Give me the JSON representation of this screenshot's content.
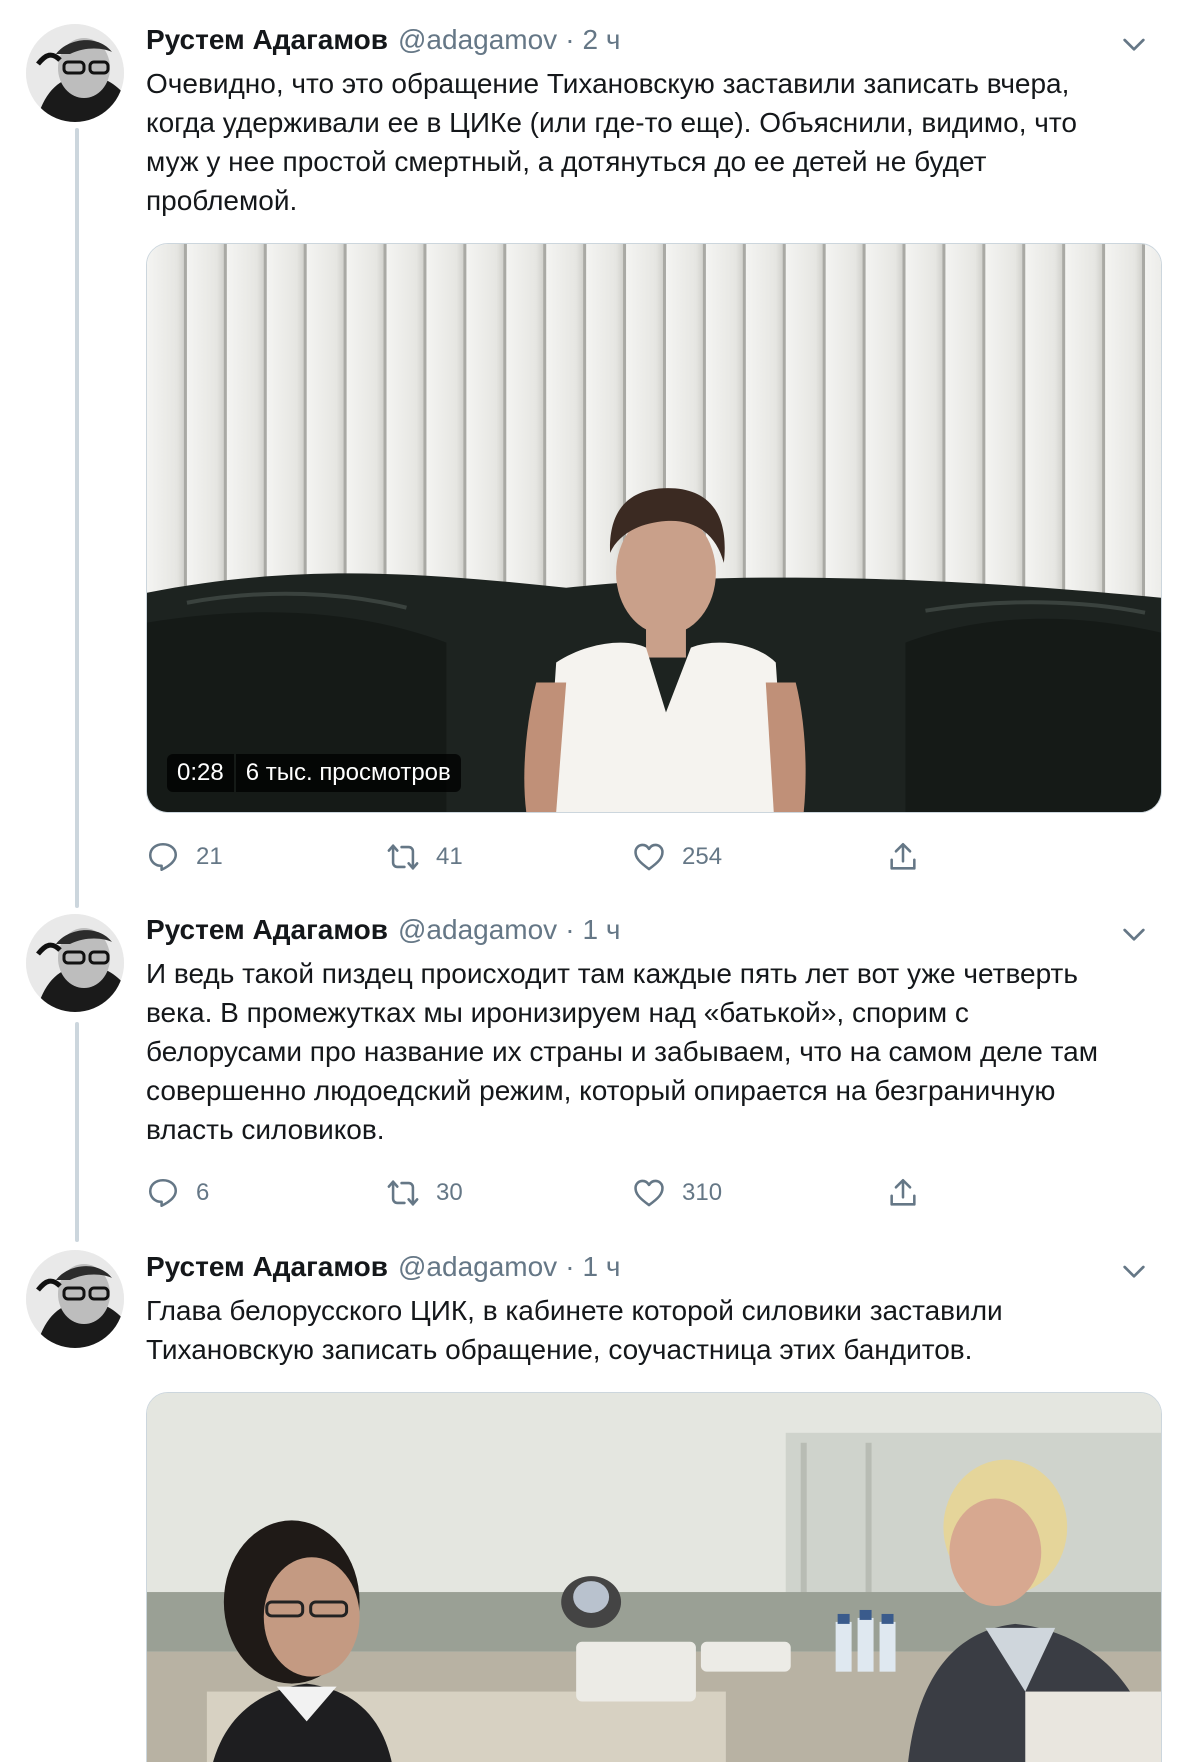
{
  "tweets": [
    {
      "name": "Рустем Адагамов",
      "handle": "@adagamov",
      "separator": "·",
      "time": "2 ч",
      "lines": [
        "Очевидно, что это обращение Тихановскую заставили записать вчера,",
        "когда удерживали ее в ЦИКе (или где-то еще). Объяснили, видимо, что",
        "муж у нее простой смертный, а дотянуться до ее детей не будет",
        "проблемой."
      ],
      "video": {
        "duration": "0:28",
        "views": "6 тыс. просмотров"
      },
      "replies": "21",
      "retweets": "41",
      "likes": "254"
    },
    {
      "name": "Рустем Адагамов",
      "handle": "@adagamov",
      "separator": "·",
      "time": "1 ч",
      "lines": [
        "И ведь такой пиздец происходит там каждые пять лет вот уже четверть",
        "века. В промежутках мы иронизируем над «батькой», спорим с",
        "белорусами про название их страны и забываем, что на самом деле там",
        "совершенно людоедский режим, который опирается на безграничную",
        "власть силовиков."
      ],
      "replies": "6",
      "retweets": "30",
      "likes": "310"
    },
    {
      "name": "Рустем Адагамов",
      "handle": "@adagamov",
      "separator": "·",
      "time": "1 ч",
      "lines": [
        "Глава белорусского ЦИК, в кабинете которой силовики заставили",
        "Тихановскую записать обращение, соучастница этих бандитов."
      ]
    }
  ],
  "icons": {
    "reply": "reply-icon",
    "retweet": "retweet-icon",
    "like": "heart-icon",
    "share": "share-icon",
    "more": "chevron-down-icon"
  },
  "colors": {
    "text": "#14171a",
    "secondary": "#657786",
    "thread_line": "#ccd6dd"
  }
}
